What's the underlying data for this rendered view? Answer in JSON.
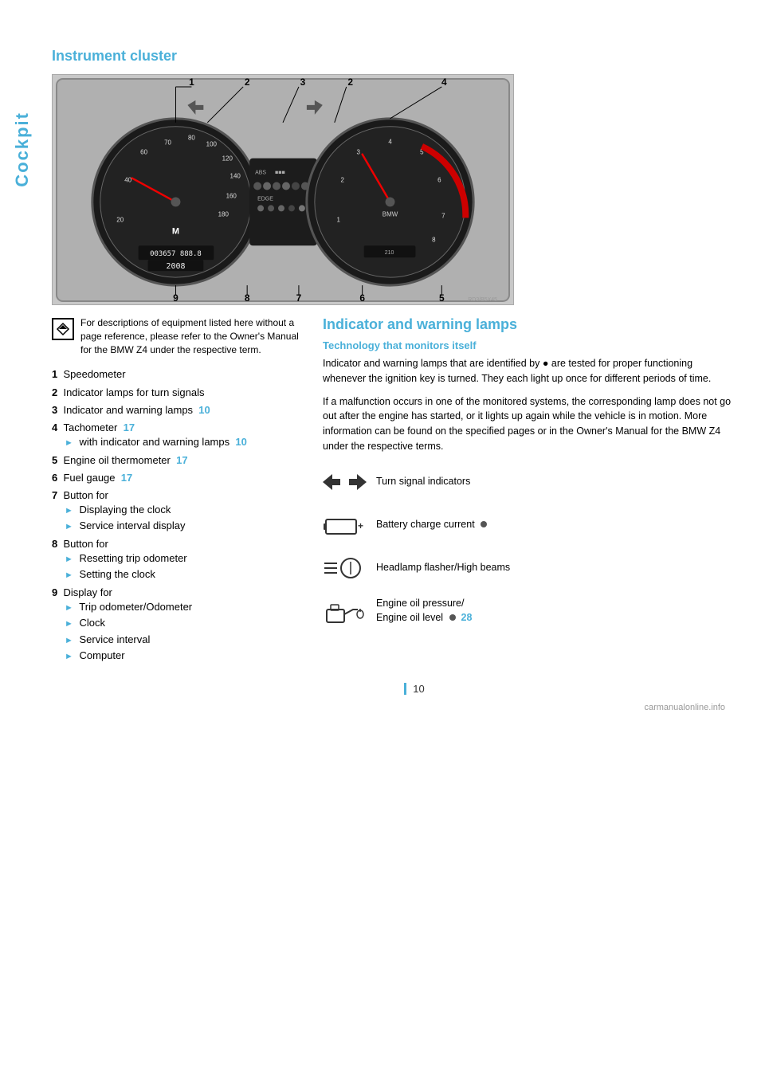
{
  "sidebar": {
    "label": "Cockpit"
  },
  "left": {
    "section_title": "Instrument cluster",
    "note": "For descriptions of equipment listed here without a page reference, please refer to the Owner's Manual for the BMW Z4 under the respective term.",
    "items": [
      {
        "num": "1",
        "label": "Speedometer",
        "sub": []
      },
      {
        "num": "2",
        "label": "Indicator lamps for turn signals",
        "sub": []
      },
      {
        "num": "3",
        "label": "Indicator and warning lamps",
        "page_ref": "10",
        "sub": []
      },
      {
        "num": "4",
        "label": "Tachometer",
        "page_ref": "17",
        "sub": [
          "with indicator and warning lamps 10"
        ]
      },
      {
        "num": "5",
        "label": "Engine oil thermometer",
        "page_ref": "17",
        "sub": []
      },
      {
        "num": "6",
        "label": "Fuel gauge",
        "page_ref": "17",
        "sub": []
      },
      {
        "num": "7",
        "label": "Button for",
        "sub": [
          "Displaying the clock",
          "Service interval display"
        ]
      },
      {
        "num": "8",
        "label": "Button for",
        "sub": [
          "Resetting trip odometer",
          "Setting the clock"
        ]
      },
      {
        "num": "9",
        "label": "Display for",
        "sub": [
          "Trip odometer/Odometer",
          "Clock",
          "Service interval",
          "Computer"
        ]
      }
    ]
  },
  "right": {
    "section_title": "Indicator and warning lamps",
    "sub_title": "Technology that monitors itself",
    "paragraph1": "Indicator and warning lamps that are identified by ● are tested for proper functioning whenever the ignition key is turned. They each light up once for different periods of time.",
    "paragraph2": "If a malfunction occurs in one of the monitored systems, the corresponding lamp does not go out after the engine has started, or it lights up again while the vehicle is in motion. More information can be found on the specified pages or in the Owner's Manual for the BMW Z4 under the respective terms.",
    "indicators": [
      {
        "id": "turn-signal",
        "label": "Turn signal indicators",
        "has_dot": false
      },
      {
        "id": "battery",
        "label": "Battery charge current",
        "has_dot": true
      },
      {
        "id": "headlamp",
        "label": "Headlamp flasher/High beams",
        "has_dot": false
      },
      {
        "id": "oil",
        "label": "Engine oil pressure/\nEngine oil level",
        "page_ref": "28",
        "has_dot": true
      }
    ]
  },
  "page_number": "10",
  "watermark": "carmanualonline.info",
  "callouts": {
    "top": [
      "1",
      "2",
      "3",
      "2",
      "4"
    ],
    "bottom": [
      "9",
      "8",
      "7",
      "6",
      "5"
    ]
  }
}
